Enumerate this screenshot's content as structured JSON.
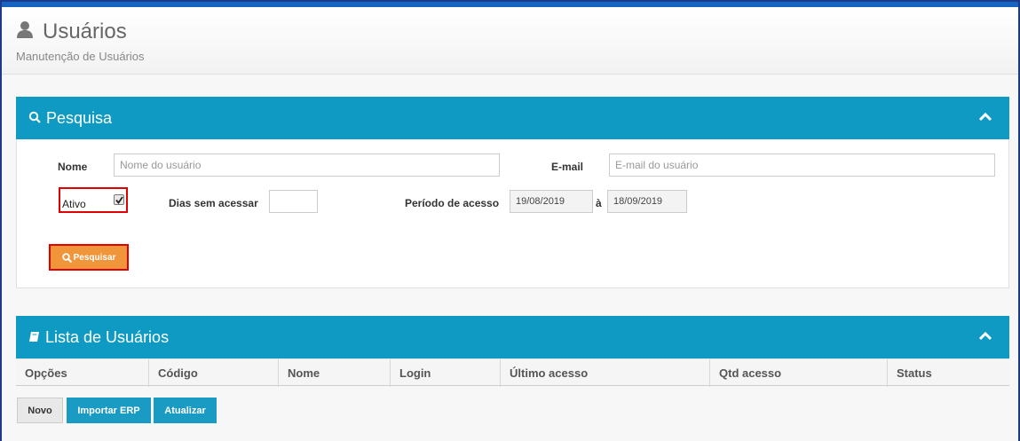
{
  "header": {
    "title": "Usuários",
    "subtitle": "Manutenção de Usuários"
  },
  "search_panel": {
    "title": "Pesquisa",
    "fields": {
      "name_label": "Nome",
      "name_placeholder": "Nome do usuário",
      "email_label": "E-mail",
      "email_placeholder": "E-mail do usuário",
      "active_label": "Ativo",
      "active_checked": true,
      "days_label": "Dias sem acessar",
      "days_value": "",
      "period_label": "Período de acesso",
      "period_from": "19/08/2019",
      "period_sep": "à",
      "period_to": "18/09/2019"
    },
    "search_button": "Pesquisar"
  },
  "list_panel": {
    "title": "Lista de Usuários",
    "columns": [
      "Opções",
      "Código",
      "Nome",
      "Login",
      "Último acesso",
      "Qtd acesso",
      "Status"
    ]
  },
  "actions": {
    "new_label": "Novo",
    "import_label": "Importar ERP",
    "refresh_label": "Atualizar"
  },
  "colors": {
    "panel_header": "#0e9ac2",
    "search_button": "#f0953a",
    "highlight_box": "#e00000",
    "action_button": "#1a9bc4"
  },
  "icons": [
    "user-icon",
    "search-icon",
    "chevron-up-icon",
    "book-icon"
  ]
}
